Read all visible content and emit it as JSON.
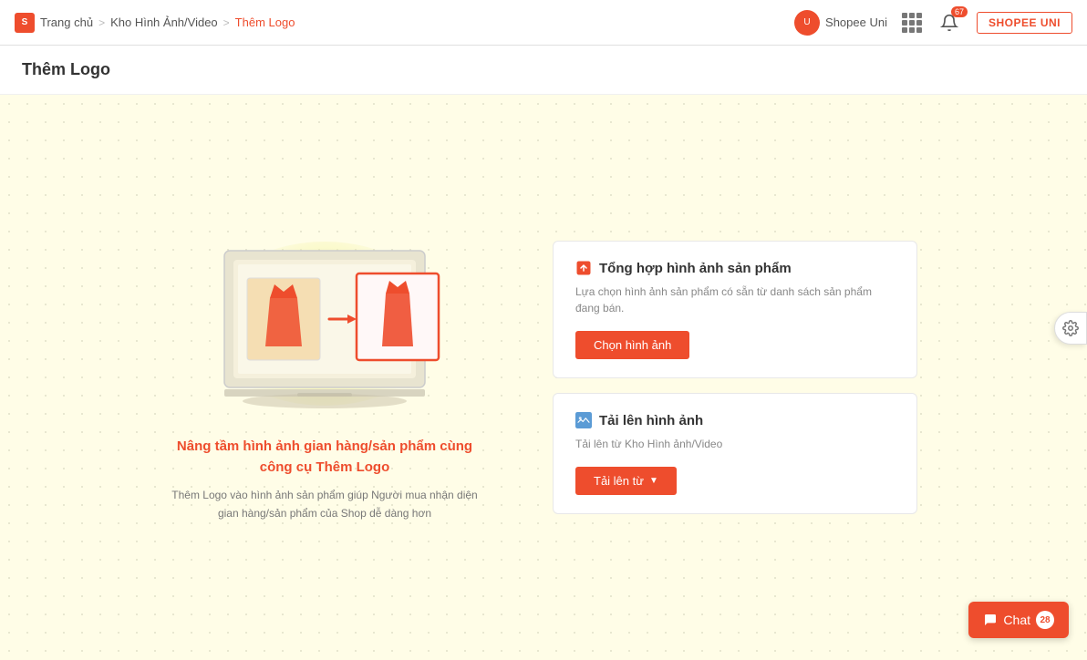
{
  "header": {
    "logo_text": "S",
    "breadcrumb": {
      "home": "Trang chủ",
      "separator1": ">",
      "media": "Kho Hình Ảnh/Video",
      "separator2": ">",
      "current": "Thêm Logo"
    },
    "shopee_uni_label": "Shopee Uni",
    "notification_count": "67",
    "shopee_uni_btn": "SHOPEE UNI"
  },
  "page_title": "Thêm Logo",
  "illustration": {
    "title": "Nâng tầm hình ảnh gian hàng/sản phẩm cùng công cụ Thêm Logo",
    "description": "Thêm Logo vào hình ảnh sản phẩm giúp Người mua nhận diện gian hàng/sản phẩm của Shop dễ dàng hơn"
  },
  "options": {
    "card1": {
      "icon": "🖼",
      "icon_color": "#ee4d2d",
      "title": "Tổng hợp hình ảnh sản phẩm",
      "description": "Lựa chọn hình ảnh sản phẩm có sẵn từ danh sách sản phẩm đang bán.",
      "button_label": "Chọn hình ảnh"
    },
    "card2": {
      "icon": "🏔",
      "icon_color": "#5b9bd5",
      "title": "Tải lên hình ảnh",
      "description": "Tải lên từ Kho Hình ảnh/Video",
      "button_label": "Tải lên từ",
      "button_arrow": "▼"
    }
  },
  "chat": {
    "label": "Chat",
    "badge": "28"
  },
  "floating_settings": {
    "icon": "⚙"
  }
}
